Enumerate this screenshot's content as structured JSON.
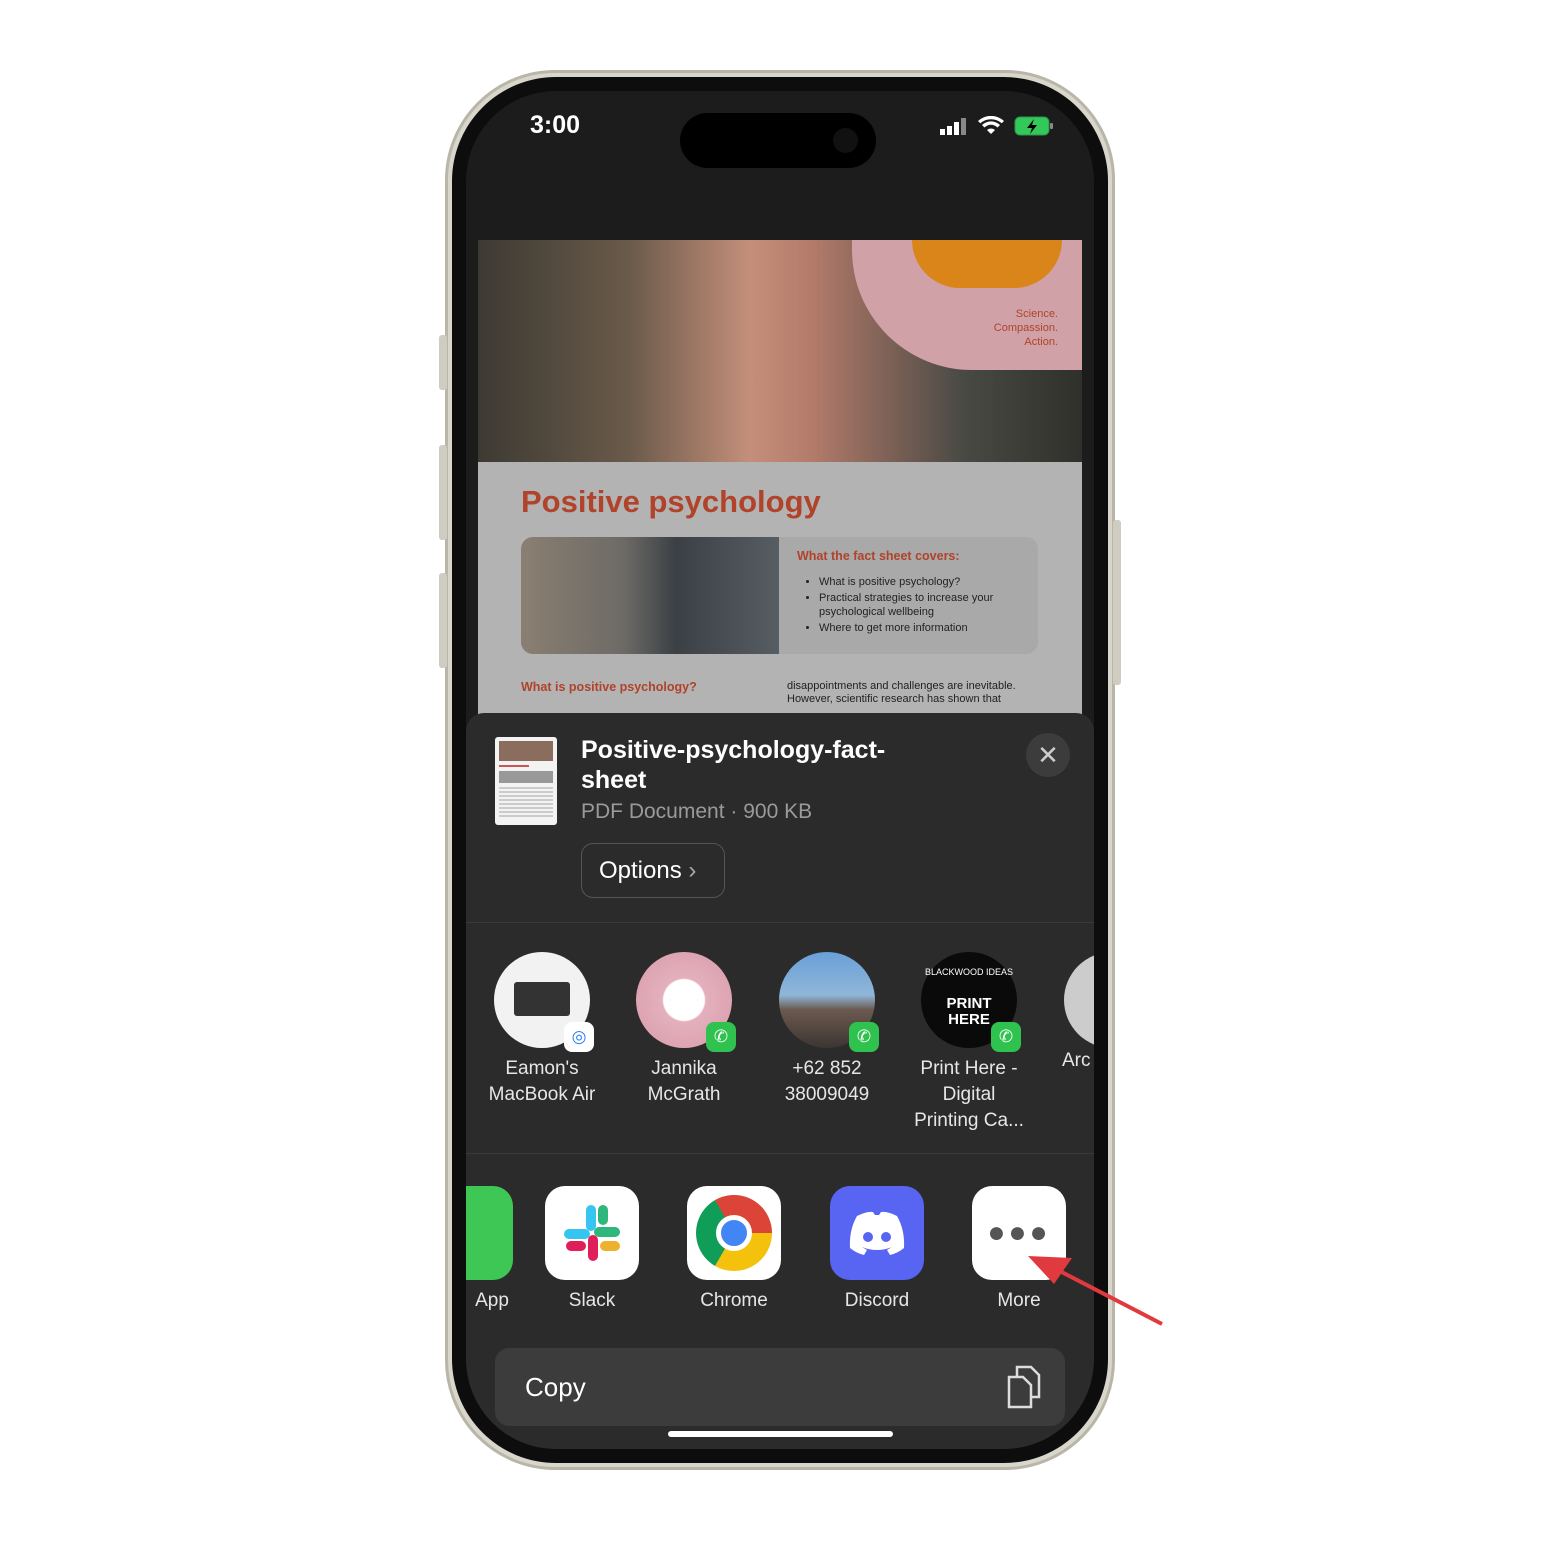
{
  "status": {
    "time": "3:00"
  },
  "document": {
    "tagline": [
      "Science.",
      "Compassion.",
      "Action."
    ],
    "title": "Positive psychology",
    "covers_heading": "What the fact sheet covers:",
    "covers_items": [
      "What is positive psychology?",
      "Practical strategies to increase your psychological wellbeing",
      "Where to get more information"
    ],
    "section_heading": "What is positive psychology?",
    "section_text": "disappointments and challenges are inevitable. However, scientific research has shown that"
  },
  "share": {
    "file_name": "Positive-psychology-fact-sheet",
    "file_meta": "PDF Document · 900 KB",
    "options_label": "Options",
    "people": [
      {
        "name": "Eamon's MacBook Air",
        "badge": "airdrop"
      },
      {
        "name": "Jannika McGrath",
        "badge": "whatsapp"
      },
      {
        "name": "+62 852 38009049",
        "badge": "whatsapp"
      },
      {
        "name": "Print Here - Digital Printing Ca...",
        "badge": "whatsapp",
        "avatar_text": [
          "BLACKWOOD IDEAS",
          "PRINT",
          "HERE"
        ]
      },
      {
        "name": "Arc"
      }
    ],
    "apps": [
      {
        "name": "App"
      },
      {
        "name": "Slack"
      },
      {
        "name": "Chrome"
      },
      {
        "name": "Discord",
        "color": "#5865f2"
      },
      {
        "name": "More"
      }
    ],
    "copy_label": "Copy"
  },
  "annotation": {
    "arrow_color": "#e0393e"
  }
}
